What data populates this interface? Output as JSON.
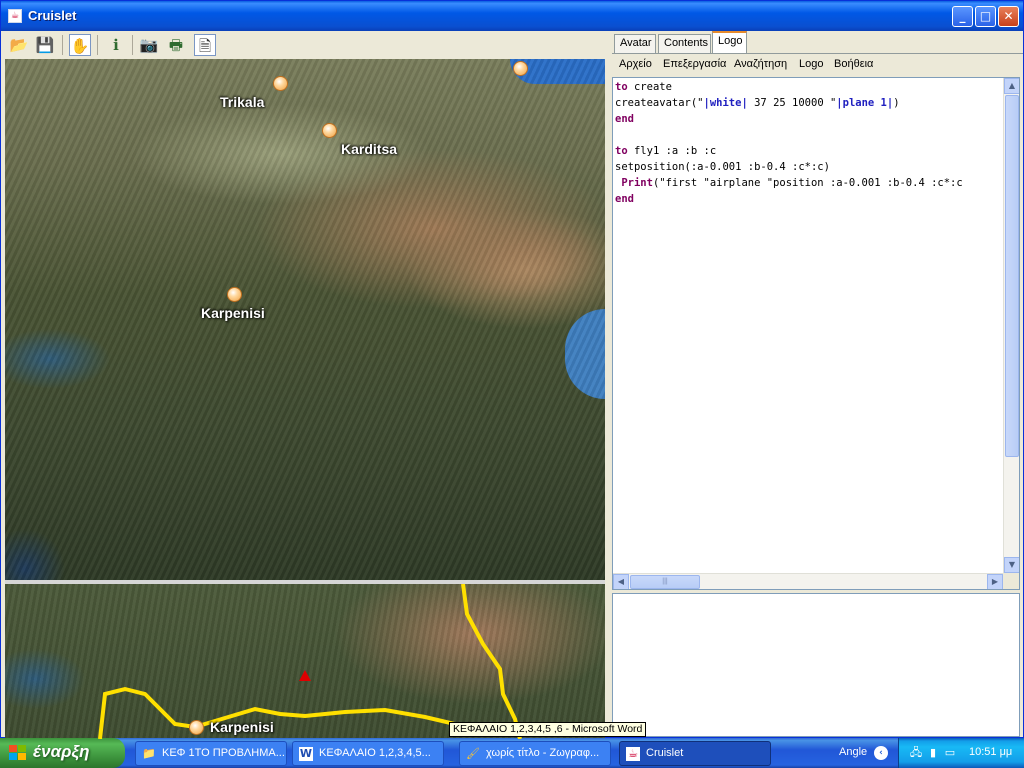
{
  "window": {
    "title": "Cruislet",
    "icon": "java-cup-icon",
    "controls": [
      "minimize",
      "maximize",
      "close"
    ]
  },
  "toolbar": {
    "buttons": [
      {
        "name": "open-folder-icon"
      },
      {
        "name": "save-disk-icon"
      },
      {
        "name": "hand-pan-icon",
        "active": true
      },
      {
        "name": "info-icon"
      },
      {
        "name": "camera-icon"
      },
      {
        "name": "printer-icon"
      },
      {
        "name": "text-frame-icon"
      }
    ]
  },
  "map": {
    "top_places": [
      "Trikala",
      "Karditsa",
      "Karpenisi"
    ],
    "bottom_places": [
      "Karpenisi"
    ],
    "route_color": "#ffe000",
    "marker_color": "#e00000"
  },
  "tabs": [
    "Avatar",
    "Contents",
    "Logo"
  ],
  "active_tab": "Logo",
  "menu": [
    "Αρχείο",
    "Επεξεργασία",
    "Αναζήτηση",
    "Logo",
    "Βοήθεια"
  ],
  "code": {
    "line1_kw": "to",
    "line1_rest": " create",
    "line2_pre": "createavatar(\"",
    "line2_str1": "|white|",
    "line2_mid": " 37 25 10000 \"",
    "line2_str2": "|plane 1|",
    "line2_post": ")",
    "line3": "end",
    "line5_kw": "to",
    "line5_rest": " fly1 :a :b :c",
    "line6": "setposition(:a-0.001 :b-0.4 :c*:c)",
    "line7_fn": " Print",
    "line7_rest": "(\"first \"airplane \"position :a-0.001 :b-0.4 :c*:c",
    "line8": "end"
  },
  "tooltip": "ΚΕΦΑΛΑΙΟ 1,2,3,4,5 ,6 - Microsoft Word",
  "taskbar": {
    "start_label": "έναρξη",
    "tasks": [
      {
        "label": "ΚΕΦ 1ΤΟ ΠΡΟΒΛΗΜΑ...",
        "icon": "folder-icon",
        "active": false
      },
      {
        "label": "ΚΕΦΑΛΑΙΟ 1,2,3,4,5...",
        "icon": "word-icon",
        "active": false
      },
      {
        "label": "χωρίς τίτλο - Ζωγραφ...",
        "icon": "paint-icon",
        "active": false
      },
      {
        "label": "Cruislet",
        "icon": "java-cup-icon",
        "active": true
      }
    ],
    "language_bar": "Angle",
    "clock": "10:51 μμ"
  }
}
